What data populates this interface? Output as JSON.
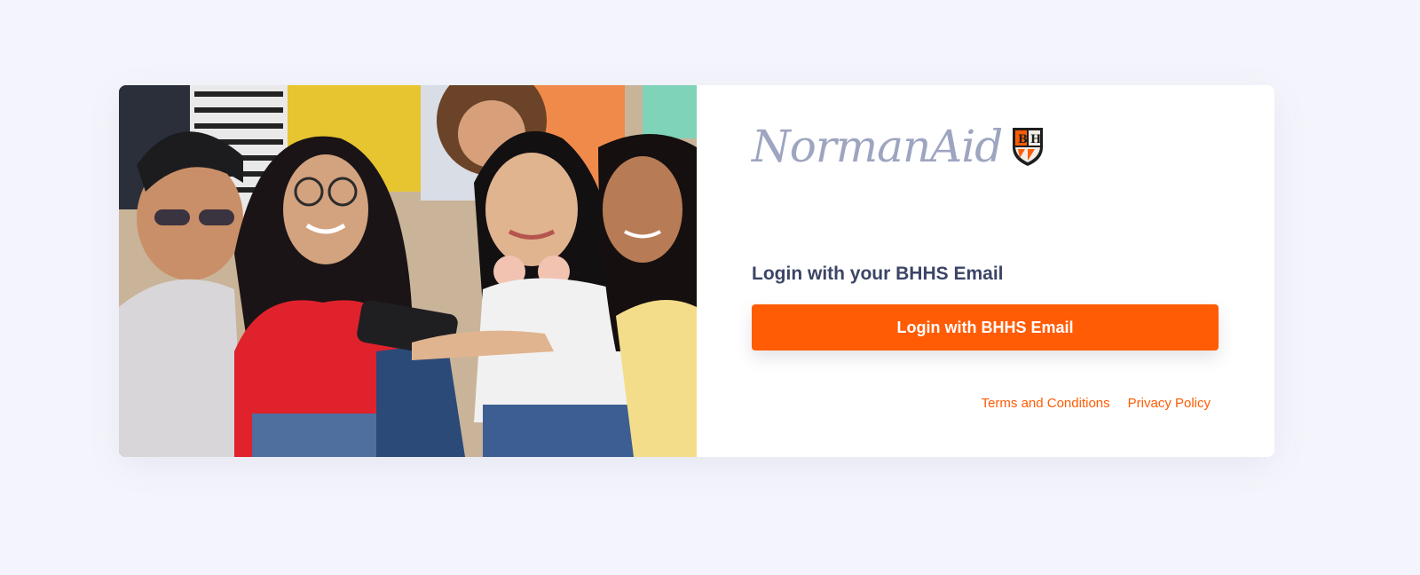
{
  "hero": {
    "image": "group-of-students-taking-selfie-photo"
  },
  "logo": {
    "wordmark": "NormanAid",
    "crest_letters": [
      "B",
      "H"
    ],
    "colors": {
      "wordmark": "#9ea5c0",
      "crest_orange": "#ff5c05",
      "crest_dark": "#1e1e1e"
    }
  },
  "login": {
    "heading": "Login with your BHHS Email",
    "button_label": "Login with BHHS Email"
  },
  "footer_links": {
    "terms": "Terms and Conditions",
    "privacy": "Privacy Policy"
  },
  "colors": {
    "accent": "#ff5c05",
    "heading": "#3c4566",
    "background": "#f4f5fc"
  }
}
